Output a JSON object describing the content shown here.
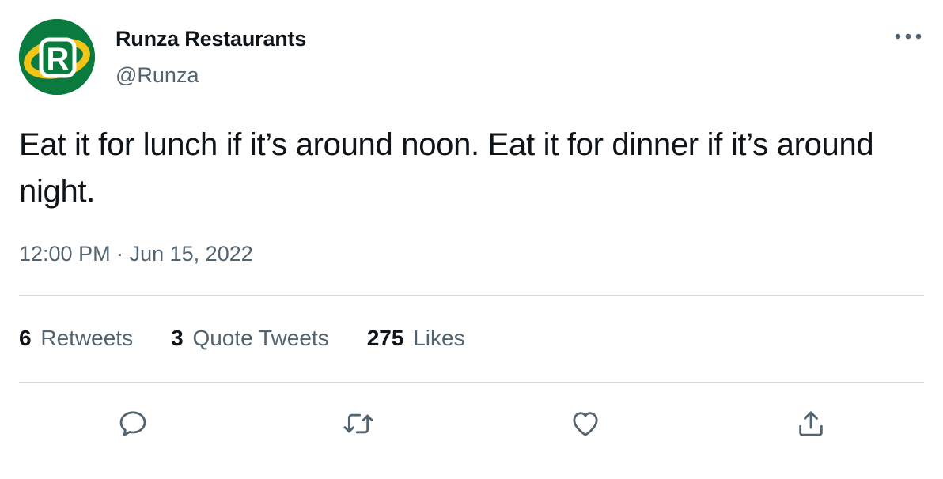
{
  "author": {
    "display_name": "Runza Restaurants",
    "handle": "@Runza",
    "avatar_logo_letter": "R",
    "avatar_colors": {
      "background": "#0b7a3e",
      "ring": "#f2c418",
      "letter": "#ffffff"
    }
  },
  "tweet": {
    "text": "Eat it for lunch if it’s around noon. Eat it for dinner if it’s around night.",
    "time": "12:00 PM",
    "separator": "·",
    "date": "Jun 15, 2022"
  },
  "stats": {
    "retweets": {
      "count": "6",
      "label": "Retweets"
    },
    "quote_tweets": {
      "count": "3",
      "label": "Quote Tweets"
    },
    "likes": {
      "count": "275",
      "label": "Likes"
    }
  },
  "actions": [
    {
      "name": "reply",
      "icon": "reply-icon"
    },
    {
      "name": "retweet",
      "icon": "retweet-icon"
    },
    {
      "name": "like",
      "icon": "heart-icon"
    },
    {
      "name": "share",
      "icon": "share-icon"
    }
  ],
  "colors": {
    "text_primary": "#0f1419",
    "text_secondary": "#536471",
    "divider": "#cfd9de",
    "icon": "#536471"
  }
}
